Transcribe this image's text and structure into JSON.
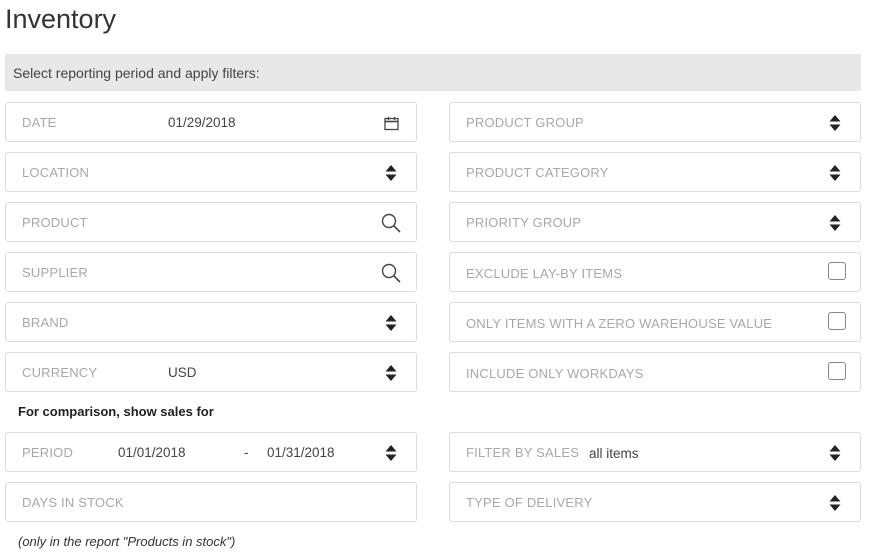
{
  "page": {
    "title": "Inventory",
    "banner": "Select reporting period and apply filters:"
  },
  "left_fields": {
    "date": {
      "label": "DATE",
      "value": "01/29/2018",
      "icon": "calendar-icon"
    },
    "location": {
      "label": "LOCATION",
      "icon": "sort-icon"
    },
    "product": {
      "label": "PRODUCT",
      "icon": "search-icon"
    },
    "supplier": {
      "label": "SUPPLIER",
      "icon": "search-icon"
    },
    "brand": {
      "label": "BRAND",
      "icon": "sort-icon"
    },
    "currency": {
      "label": "CURRENCY",
      "value": "USD",
      "icon": "sort-icon"
    }
  },
  "right_fields": {
    "product_group": {
      "label": "PRODUCT GROUP",
      "icon": "sort-icon"
    },
    "product_category": {
      "label": "PRODUCT CATEGORY",
      "icon": "sort-icon"
    },
    "priority_group": {
      "label": "PRIORITY GROUP",
      "icon": "sort-icon"
    },
    "exclude_layby": {
      "label": "EXCLUDE LAY-BY ITEMS",
      "checked": false
    },
    "zero_warehouse": {
      "label": "ONLY ITEMS WITH A ZERO WAREHOUSE VALUE",
      "checked": false
    },
    "only_workdays": {
      "label": "INCLUDE ONLY WORKDAYS",
      "checked": false
    }
  },
  "comparison": {
    "heading": "For comparison, show sales for",
    "period": {
      "label": "PERIOD",
      "from": "01/01/2018",
      "separator": "-",
      "to": "01/31/2018",
      "icon": "sort-icon"
    },
    "filter_by_sales": {
      "label": "FILTER BY SALES",
      "value": "all items",
      "icon": "sort-icon"
    },
    "days_in_stock": {
      "label": "DAYS IN STOCK"
    },
    "type_of_delivery": {
      "label": "TYPE OF DELIVERY",
      "icon": "sort-icon"
    },
    "footnote": "(only in the report \"Products in stock\")"
  },
  "colors": {
    "banner_bg": "#e8e8e8",
    "border": "#dcdcdc",
    "label": "#a8a8a8",
    "text": "#333333"
  }
}
